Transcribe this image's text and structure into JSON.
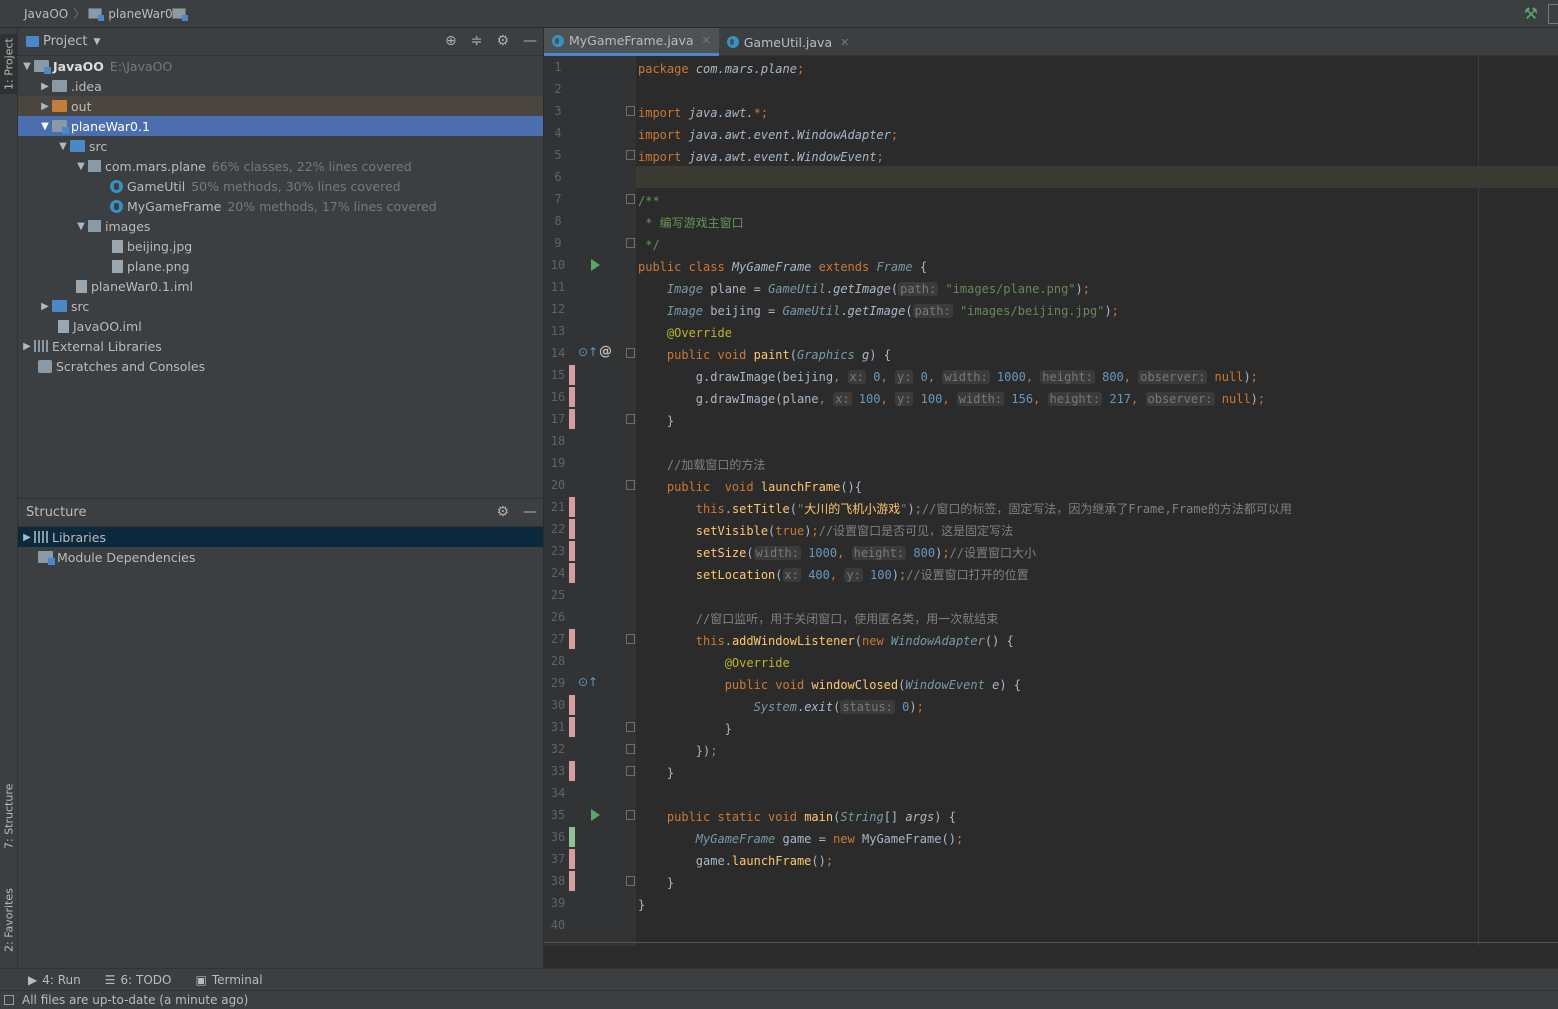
{
  "breadcrumb": {
    "root": "JavaOO",
    "module": "planeWar0.1"
  },
  "leftstrip": {
    "project_tab": "1: Project",
    "structure_tab": "7: Structure",
    "favorites_tab": "2: Favorites"
  },
  "project_panel": {
    "title": "Project",
    "tree": [
      {
        "label": "JavaOO",
        "extra": "E:\\JavaOO"
      },
      {
        "label": ".idea"
      },
      {
        "label": "out"
      },
      {
        "label": "planeWar0.1"
      },
      {
        "label": "src"
      },
      {
        "label": "com.mars.plane",
        "extra": "66% classes, 22% lines covered"
      },
      {
        "label": "GameUtil",
        "extra": "50% methods, 30% lines covered"
      },
      {
        "label": "MyGameFrame",
        "extra": "20% methods, 17% lines covered"
      },
      {
        "label": "images"
      },
      {
        "label": "beijing.jpg"
      },
      {
        "label": "plane.png"
      },
      {
        "label": "planeWar0.1.iml"
      },
      {
        "label": "src"
      },
      {
        "label": "JavaOO.iml"
      },
      {
        "label": "External Libraries"
      },
      {
        "label": "Scratches and Consoles"
      }
    ]
  },
  "structure_panel": {
    "title": "Structure",
    "items": [
      {
        "label": "Libraries"
      },
      {
        "label": "Module Dependencies"
      }
    ]
  },
  "editor": {
    "tabs": [
      {
        "label": "MyGameFrame.java"
      },
      {
        "label": "GameUtil.java"
      }
    ],
    "line_count": 40
  },
  "bottom_tabs": {
    "run": "4: Run",
    "todo": "6: TODO",
    "terminal": "Terminal"
  },
  "status": {
    "text": "All files are up-to-date (a minute ago)"
  },
  "colors": {
    "selection": "#4b6eaf",
    "keyword": "#cc7832",
    "string": "#6a8759",
    "number": "#6897bb"
  }
}
